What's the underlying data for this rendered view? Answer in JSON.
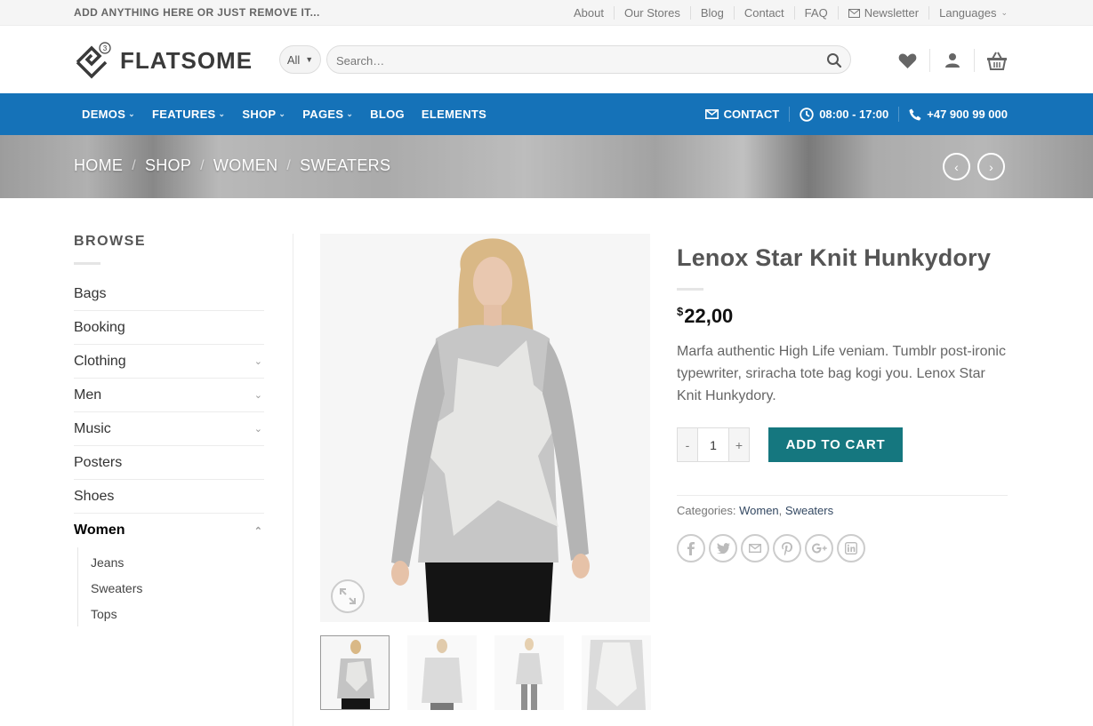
{
  "topbar": {
    "promo": "ADD ANYTHING HERE OR JUST REMOVE IT...",
    "links": [
      "About",
      "Our Stores",
      "Blog",
      "Contact",
      "FAQ"
    ],
    "newsletter": "Newsletter",
    "languages": "Languages"
  },
  "header": {
    "logo_text": "FLATSOME",
    "logo_badge": "3",
    "category_select": "All",
    "search_placeholder": "Search…"
  },
  "mainnav": {
    "items": [
      "DEMOS",
      "FEATURES",
      "SHOP",
      "PAGES",
      "BLOG",
      "ELEMENTS"
    ],
    "contact": "CONTACT",
    "hours": "08:00 - 17:00",
    "phone": "+47 900 99 000"
  },
  "breadcrumb": {
    "items": [
      "HOME",
      "SHOP",
      "WOMEN",
      "SWEATERS"
    ],
    "separator": "/"
  },
  "sidebar": {
    "title": "BROWSE",
    "categories": [
      {
        "label": "Bags",
        "expandable": false
      },
      {
        "label": "Booking",
        "expandable": false
      },
      {
        "label": "Clothing",
        "expandable": true
      },
      {
        "label": "Men",
        "expandable": true
      },
      {
        "label": "Music",
        "expandable": true
      },
      {
        "label": "Posters",
        "expandable": false
      },
      {
        "label": "Shoes",
        "expandable": false
      },
      {
        "label": "Women",
        "expandable": true
      }
    ],
    "subcategories": [
      "Jeans",
      "Sweaters",
      "Tops"
    ]
  },
  "product": {
    "title": "Lenox Star Knit Hunkydory",
    "currency": "$",
    "price": "22,00",
    "description": "Marfa authentic High Life veniam. Tumblr post-ironic typewriter, sriracha tote bag kogi you. Lenox Star Knit Hunkydory.",
    "quantity": "1",
    "qty_minus": "-",
    "qty_plus": "+",
    "add_to_cart": "ADD TO CART",
    "categories_label": "Categories:",
    "categories": [
      "Women",
      "Sweaters"
    ]
  },
  "colors": {
    "nav_blue": "#1572b8",
    "cart_button": "#15777f",
    "topbar_bg": "#f5f5f5"
  },
  "icons": [
    "heart-icon",
    "user-icon",
    "basket-icon",
    "search-icon",
    "mail-icon",
    "clock-icon",
    "phone-icon",
    "zoom-icon",
    "facebook-icon",
    "twitter-icon",
    "email-icon",
    "pinterest-icon",
    "googleplus-icon",
    "linkedin-icon"
  ]
}
